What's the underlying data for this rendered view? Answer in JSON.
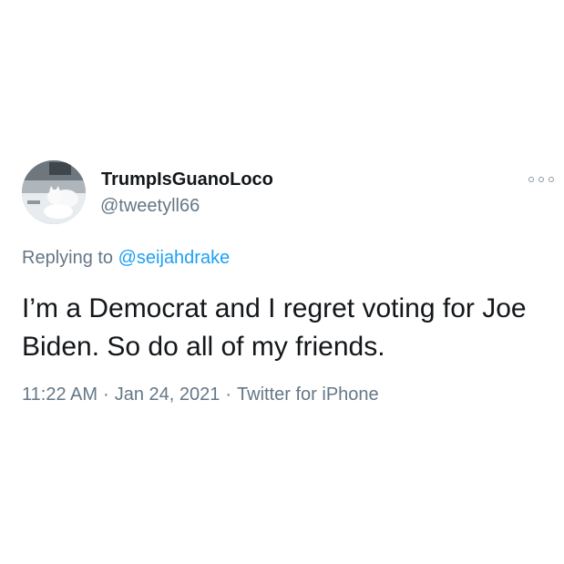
{
  "tweet": {
    "display_name": "TrumpIsGuanoLoco",
    "handle": "@tweetyll66",
    "replying_prefix": "Replying to ",
    "replying_to": "@seijahdrake",
    "text_line1": "I’m a Democrat and I regret voting for Joe",
    "text_line2": "Biden. So do all of my friends.",
    "time": "11:22 AM",
    "date": "Jan 24, 2021",
    "separator": "·",
    "source": "Twitter for iPhone",
    "more_icon": "more-horizontal-icon"
  },
  "colors": {
    "text": "#14171a",
    "secondary": "#657786",
    "link": "#1da1f2",
    "background": "#ffffff"
  }
}
